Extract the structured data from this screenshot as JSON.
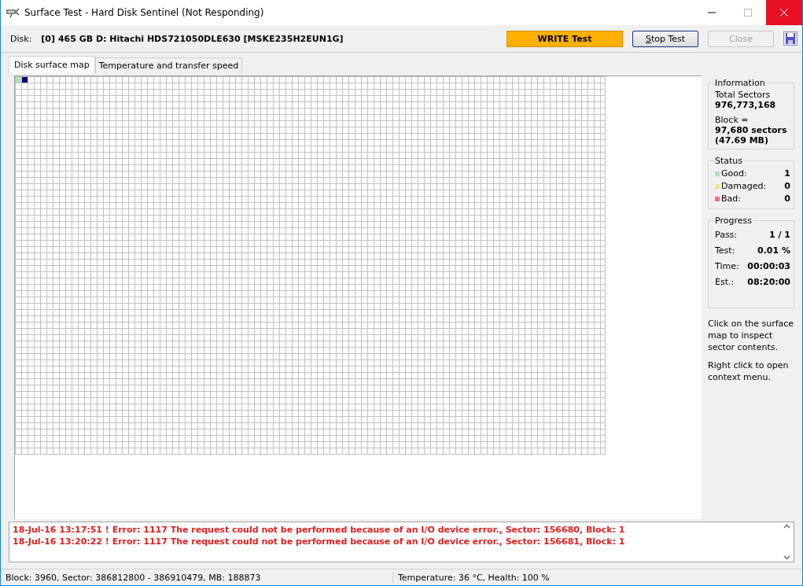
{
  "window": {
    "title": "Surface Test - Hard Disk Sentinel (Not Responding)"
  },
  "disk": {
    "label": "Disk:",
    "value": "[0] 465 GB D: Hitachi HDS721050DLE630 [MSKE235H2EUN1G]"
  },
  "test_mode": "WRITE Test",
  "buttons": [
    {
      "label": "Stop Test",
      "disabled": false
    },
    {
      "label": "Close",
      "disabled": true
    }
  ],
  "tabs": [
    {
      "label": "Disk surface map",
      "selected": true
    },
    {
      "label": "Temperature and transfer speed",
      "selected": false
    }
  ],
  "map_cells": [
    {
      "kind": "good"
    },
    {
      "kind": "current"
    }
  ],
  "information": {
    "title": "Information",
    "total_label": "Total Sectors",
    "total_value": "976,773,168",
    "block_label": "Block =",
    "block_value": "97,680 sectors",
    "block_size": "(47.69 MB)"
  },
  "status": {
    "title": "Status",
    "items": [
      {
        "label": "Good:",
        "value": "1",
        "color": "#b8e0b8"
      },
      {
        "label": "Damaged:",
        "value": "0",
        "color": "#f0e890"
      },
      {
        "label": "Bad:",
        "value": "0",
        "color": "#f07080"
      }
    ]
  },
  "progress": {
    "title": "Progress",
    "items": [
      {
        "label": "Pass:",
        "value": "1 / 1"
      },
      {
        "label": "Test:",
        "value": "0.01 %"
      },
      {
        "label": "Time:",
        "value": "00:00:03"
      },
      {
        "label": "Est.:",
        "value": "08:20:00"
      }
    ]
  },
  "hints": [
    "Click on the surface map to inspect sector contents.",
    "Right click to open context menu."
  ],
  "log": [
    "18-Jul-16  13:17:51 ! Error: 1117 The request could not be performed because of an I/O device error., Sector: 156680, Block: 1",
    "18-Jul-16  13:20:22 ! Error: 1117 The request could not be performed because of an I/O device error., Sector: 156681, Block: 1"
  ],
  "status_bar": [
    "Block: 3960, Sector: 386812800 - 386910479, MB: 188873",
    "Temperature: 36  °C,  Health: 100 %"
  ]
}
